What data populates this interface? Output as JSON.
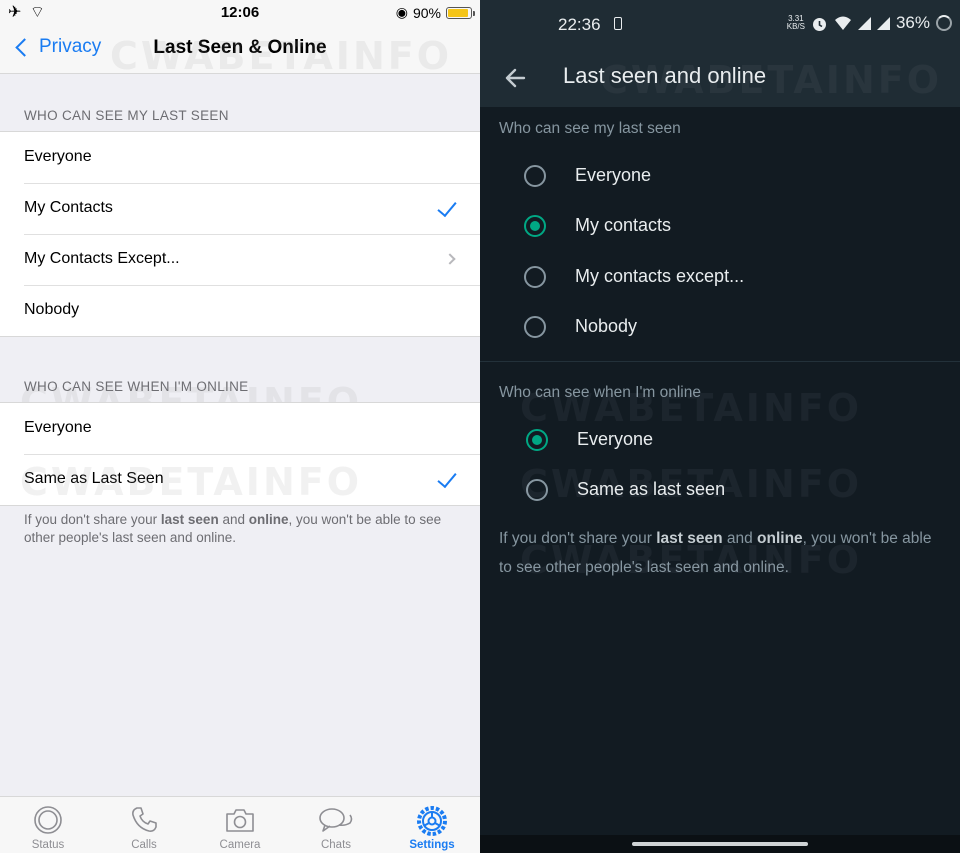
{
  "ios": {
    "status": {
      "left_icons": "✈︎ ⌔",
      "time": "12:06",
      "location_glyph": "◉",
      "battery_percent": "90%",
      "battery_level": 0.9
    },
    "nav": {
      "back_label": "Privacy",
      "title": "Last Seen & Online"
    },
    "last_seen_header": "WHO CAN SEE MY LAST SEEN",
    "last_seen_options": [
      {
        "label": "Everyone"
      },
      {
        "label": "My Contacts"
      },
      {
        "label": "My Contacts Except..."
      },
      {
        "label": "Nobody"
      }
    ],
    "online_header": "WHO CAN SEE WHEN I'M ONLINE",
    "online_options": [
      {
        "label": "Everyone"
      },
      {
        "label": "Same as Last Seen"
      }
    ],
    "footer": {
      "part1": "If you don't share your ",
      "bold1": "last seen",
      "part2": " and ",
      "bold2": "online",
      "part3": ", you won't be able to see other people's last seen and online."
    },
    "tabs": [
      {
        "label": "Status",
        "icon": "status-icon"
      },
      {
        "label": "Calls",
        "icon": "phone-icon"
      },
      {
        "label": "Camera",
        "icon": "camera-icon"
      },
      {
        "label": "Chats",
        "icon": "chat-bubbles-icon"
      },
      {
        "label": "Settings",
        "icon": "gear-icon",
        "active": true
      }
    ],
    "watermark": "CWABETAINFO"
  },
  "android": {
    "status": {
      "time": "22:36",
      "speed_top": "3.31",
      "speed_bottom": "KB/S",
      "battery_percent": "36%"
    },
    "toolbar": {
      "title": "Last seen and online"
    },
    "last_seen_header": "Who can see my last seen",
    "last_seen_options": [
      {
        "label": "Everyone",
        "selected": false
      },
      {
        "label": "My contacts",
        "selected": true
      },
      {
        "label": "My contacts except...",
        "selected": false
      },
      {
        "label": "Nobody",
        "selected": false
      }
    ],
    "online_header": "Who can see when I'm online",
    "online_options": [
      {
        "label": "Everyone",
        "selected": true
      },
      {
        "label": "Same as last seen",
        "selected": false
      }
    ],
    "footer": {
      "part1": "If you don't share your ",
      "bold1": "last seen",
      "part2": " and ",
      "bold2": "online",
      "part3": ", you won't be able to see other people's last seen and online."
    },
    "watermark": "CWABETAINFO"
  },
  "colors": {
    "ios_accent": "#1a7cf2",
    "android_accent": "#00a884",
    "android_bg": "#121b22"
  }
}
